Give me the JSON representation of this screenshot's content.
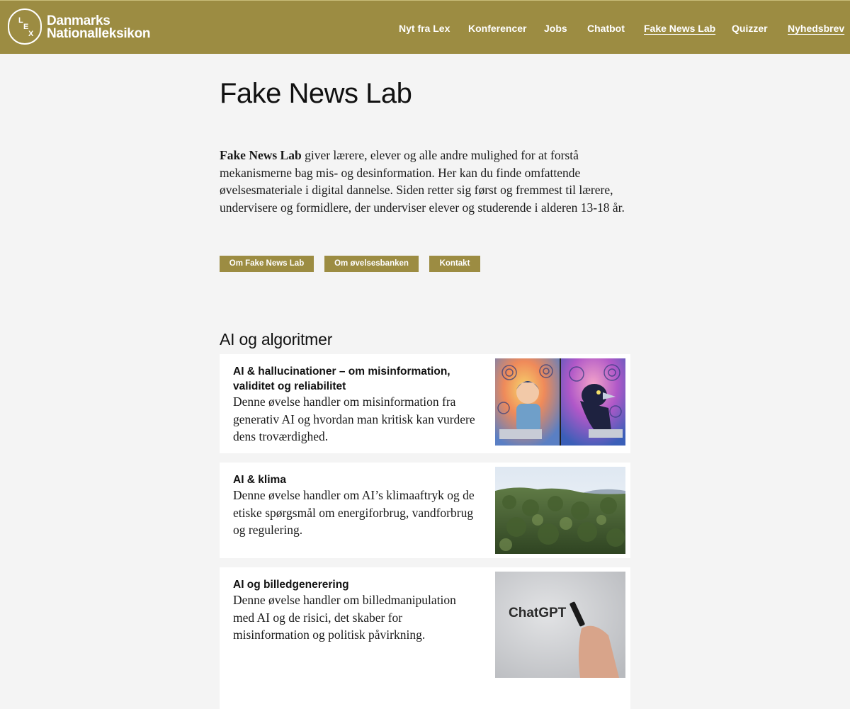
{
  "header": {
    "brand_line1": "Danmarks",
    "brand_line2": "Nationalleksikon",
    "logo_letters": [
      "L",
      "E",
      "X"
    ],
    "nav": [
      {
        "label": "Nyt fra Lex"
      },
      {
        "label": "Konferencer"
      },
      {
        "label": "Jobs"
      },
      {
        "label": "Chatbot"
      },
      {
        "label": "Fake News Lab"
      },
      {
        "label": "Quizzer"
      },
      {
        "label": "Nyhedsbrev"
      }
    ],
    "active_nav": "Fake News Lab"
  },
  "page": {
    "title": "Fake News Lab",
    "intro_bold": "Fake News Lab",
    "intro_text": " giver lærere, elever og alle andre mulighed for at forstå mekanismerne bag mis- og desinformation. Her kan du finde omfattende øvelsesmateriale i digital dannelse. Siden retter sig først og fremmest til lærere, undervisere og formidlere, der underviser elever og studerende i alderen 13-18 år.",
    "buttons": [
      "Om Fake News Lab",
      "Om øvelsesbanken",
      "Kontakt"
    ]
  },
  "section": {
    "heading": "AI og algoritmer",
    "cards": [
      {
        "title": "AI & hallucinationer – om misinformation, validitet og reliabilitet",
        "description": "Denne øvelse handler om misinformation fra generativ AI og hvordan man kritisk kan vurdere dens troværdighed."
      },
      {
        "title": "AI & klima",
        "description": "Denne øvelse handler om AI’s klimaaftryk og de etiske spørgsmål om energiforbrug, vandforbrug og regulering."
      },
      {
        "title": "AI og billedgenerering",
        "description": "Denne øvelse handler om billedmanipulation med AI og de risici, det skaber for misinformation og politisk påvirkning.",
        "image_text": "ChatGPT"
      }
    ]
  },
  "colors": {
    "accent": "#9c8c42",
    "background": "#f4f4f4",
    "card": "#ffffff"
  }
}
